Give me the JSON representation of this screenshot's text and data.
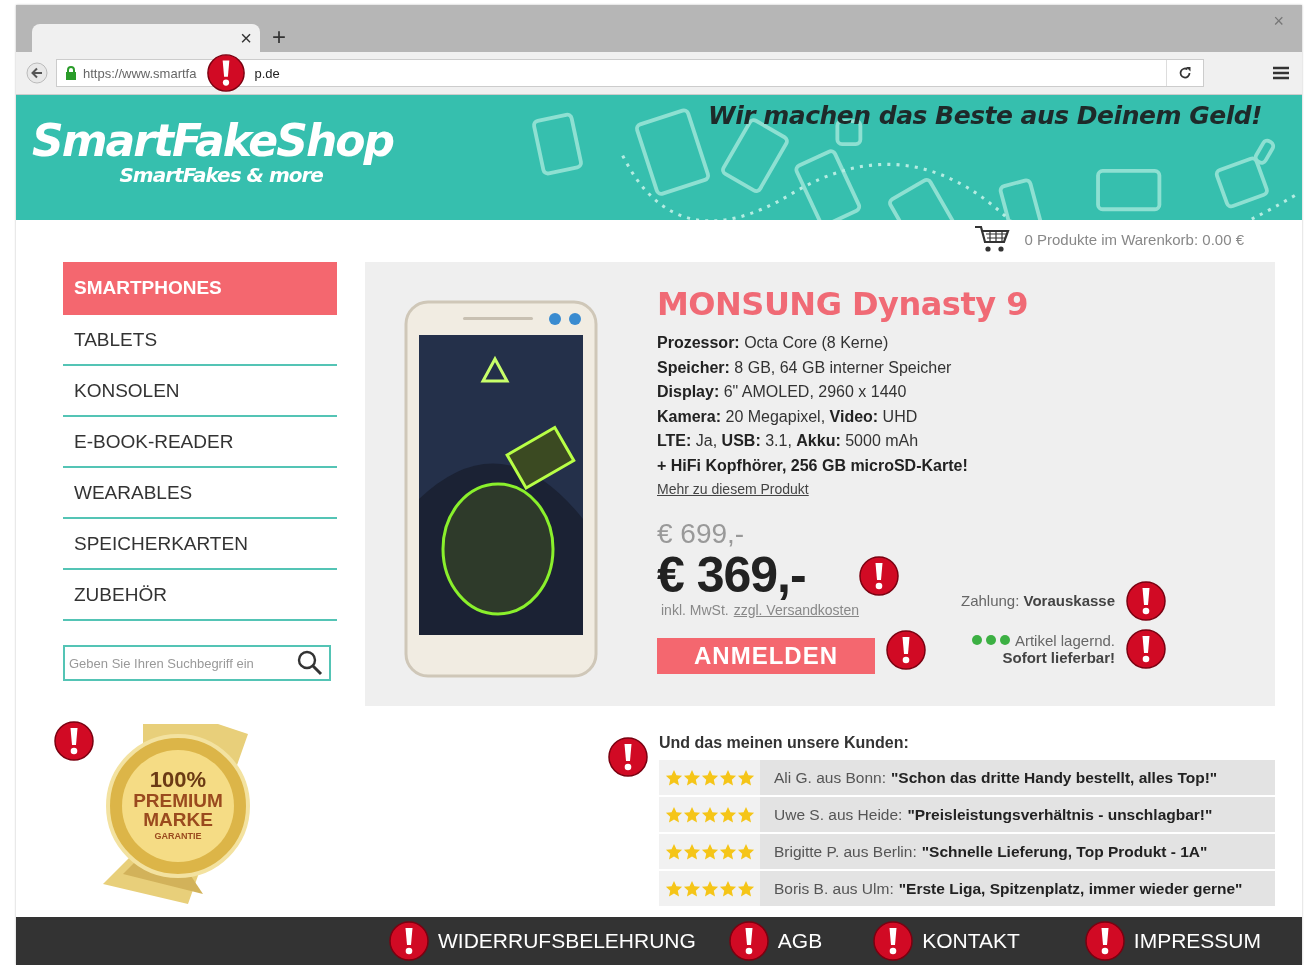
{
  "browser": {
    "tab_close": "×",
    "new_tab": "+",
    "window_close": "×",
    "url_parts": [
      "https://www.smartfa",
      "p.de"
    ]
  },
  "banner": {
    "logo": "SmartFakeShop",
    "tagline": "SmartFakes & more",
    "slogan": "Wir machen das Beste aus Deinem Geld!"
  },
  "cart": {
    "text": "0 Produkte im Warenkorb: 0.00 €"
  },
  "sidebar": {
    "items": [
      {
        "label": "SMARTPHONES",
        "selected": true
      },
      {
        "label": "TABLETS",
        "selected": false
      },
      {
        "label": "KONSOLEN",
        "selected": false
      },
      {
        "label": "E-BOOK-READER",
        "selected": false
      },
      {
        "label": "WEARABLES",
        "selected": false
      },
      {
        "label": "SPEICHERKARTEN",
        "selected": false
      },
      {
        "label": "ZUBEHÖR",
        "selected": false
      }
    ],
    "search": {
      "placeholder": "Geben Sie Ihren Suchbegriff ein"
    }
  },
  "badge": {
    "lines": [
      "100%",
      "PREMIUM",
      "MARKE",
      "GARANTIE"
    ]
  },
  "product": {
    "title": "MONSUNG Dynasty 9",
    "specs": [
      "**Prozessor:** Octa Core (8 Kerne)",
      "**Speicher:** 8 GB, 64 GB interner Speicher",
      "**Display:** 6\" AMOLED, 2960 x 1440",
      "**Kamera:** 20 Megapixel, **Video:** UHD",
      "**LTE:** Ja, **USB:** 3.1, **Akku:** 5000 mAh"
    ],
    "bonus": "+ HiFi Kopfhörer, 256 GB microSD-Karte!",
    "more_link": "Mehr zu diesem Produkt",
    "old_price": "€ 699,-",
    "price": "€ 369,-",
    "tax_note": "inkl. MwSt.",
    "shipping_link": "zzgl. Versandkosten",
    "payment": "Zahlung: **Vorauskasse**",
    "stock": "Artikel lagernd.",
    "delivery": "Sofort lieferbar!",
    "button": "ANMELDEN"
  },
  "reviews": {
    "heading": "Und das meinen unsere Kunden:",
    "items": [
      {
        "stars": 5,
        "author": "Ali G. aus Bonn:",
        "quote": "\"Schon das dritte Handy bestellt, alles Top!\""
      },
      {
        "stars": 5,
        "author": "Uwe S. aus Heide:",
        "quote": "\"Preisleistungsverhältnis - unschlagbar!\""
      },
      {
        "stars": 5,
        "author": "Brigitte P. aus Berlin:",
        "quote": "\"Schnelle Lieferung, Top Produkt - 1A\""
      },
      {
        "stars": 5,
        "author": "Boris B. aus Ulm:",
        "quote": "\"Erste Liga, Spitzenplatz, immer wieder gerne\""
      }
    ]
  },
  "footer": {
    "links": [
      "WIDERRUFSBELEHRUNG",
      "AGB",
      "KONTAKT",
      "IMPRESSUM"
    ]
  }
}
